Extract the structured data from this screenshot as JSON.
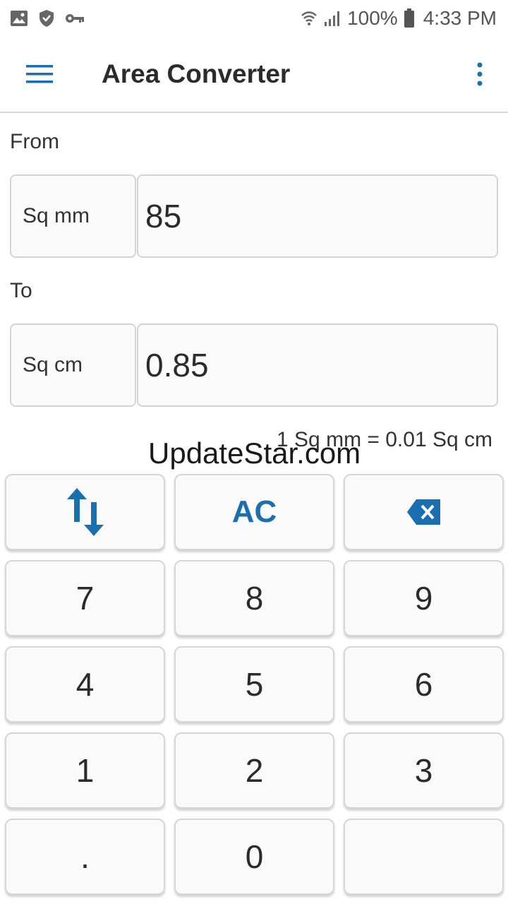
{
  "status_bar": {
    "battery_pct": "100%",
    "time": "4:33 PM",
    "icons": [
      "image-icon",
      "shield-icon",
      "key-icon",
      "wifi-icon",
      "signal-icon",
      "battery-icon"
    ]
  },
  "app_bar": {
    "title": "Area Converter",
    "menu_icon": "hamburger-menu-icon",
    "more_icon": "more-vertical-icon"
  },
  "from": {
    "label": "From",
    "unit": "Sq mm",
    "value": "85"
  },
  "to": {
    "label": "To",
    "unit": "Sq cm",
    "value": "0.85"
  },
  "ratio": "1 Sq mm = 0.01 Sq cm",
  "watermark": "UpdateStar.com",
  "keypad": {
    "swap_icon": "swap-vertical-icon",
    "clear": "AC",
    "backspace_icon": "backspace-icon",
    "keys": [
      "7",
      "8",
      "9",
      "4",
      "5",
      "6",
      "1",
      "2",
      "3",
      ".",
      "0",
      ""
    ]
  },
  "colors": {
    "accent": "#1a6fb0",
    "text": "#2b2b2b",
    "border": "#d4d4d4"
  }
}
